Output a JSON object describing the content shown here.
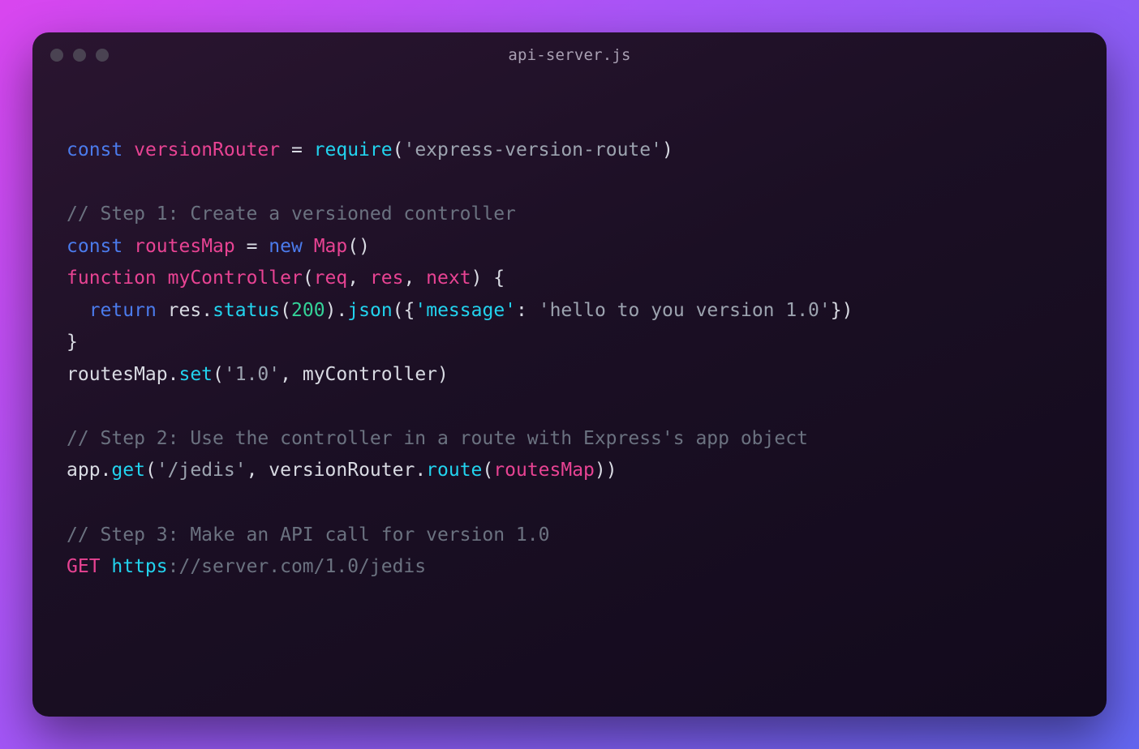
{
  "titlebar": {
    "filename": "api-server.js"
  },
  "code": {
    "l1": {
      "const": "const",
      "name": "versionRouter",
      "eq": " = ",
      "require": "require",
      "po": "(",
      "str": "'express-version-route'",
      "pc": ")"
    },
    "l2": "",
    "l3": {
      "comment": "// Step 1: Create a versioned controller"
    },
    "l4": {
      "const": "const",
      "name": "routesMap",
      "eq": " = ",
      "new": "new",
      "cls": "Map",
      "po": "(",
      "pc": ")"
    },
    "l5": {
      "function": "function",
      "name": "myController",
      "po": "(",
      "p1": "req",
      "c1": ", ",
      "p2": "res",
      "c2": ", ",
      "p3": "next",
      "pc": ")",
      "ob": " {"
    },
    "l6": {
      "indent": "  ",
      "return": "return",
      "sp": " ",
      "obj": "res",
      "d1": ".",
      "m1": "status",
      "po1": "(",
      "n": "200",
      "pc1": ")",
      "d2": ".",
      "m2": "json",
      "po2": "(",
      "ob2": "{",
      "key": "'message'",
      "colon": ": ",
      "val": "'hello to you version 1.0'",
      "cb2": "}",
      "pc2": ")"
    },
    "l7": {
      "cb": "}"
    },
    "l8": {
      "obj": "routesMap",
      "d": ".",
      "m": "set",
      "po": "(",
      "a1": "'1.0'",
      "c": ", ",
      "a2": "myController",
      "pc": ")"
    },
    "l9": "",
    "l10": {
      "comment": "// Step 2: Use the controller in a route with Express's app object"
    },
    "l11": {
      "obj": "app",
      "d1": ".",
      "m1": "get",
      "po1": "(",
      "a1": "'/jedis'",
      "c": ", ",
      "obj2": "versionRouter",
      "d2": ".",
      "m2": "route",
      "po2": "(",
      "a2": "routesMap",
      "pc2": ")",
      "pc1": ")"
    },
    "l12": "",
    "l13": {
      "comment": "// Step 3: Make an API call for version 1.0"
    },
    "l14": {
      "get": "GET ",
      "scheme": "https",
      "rest": "://server.com/1.0/jedis"
    }
  }
}
